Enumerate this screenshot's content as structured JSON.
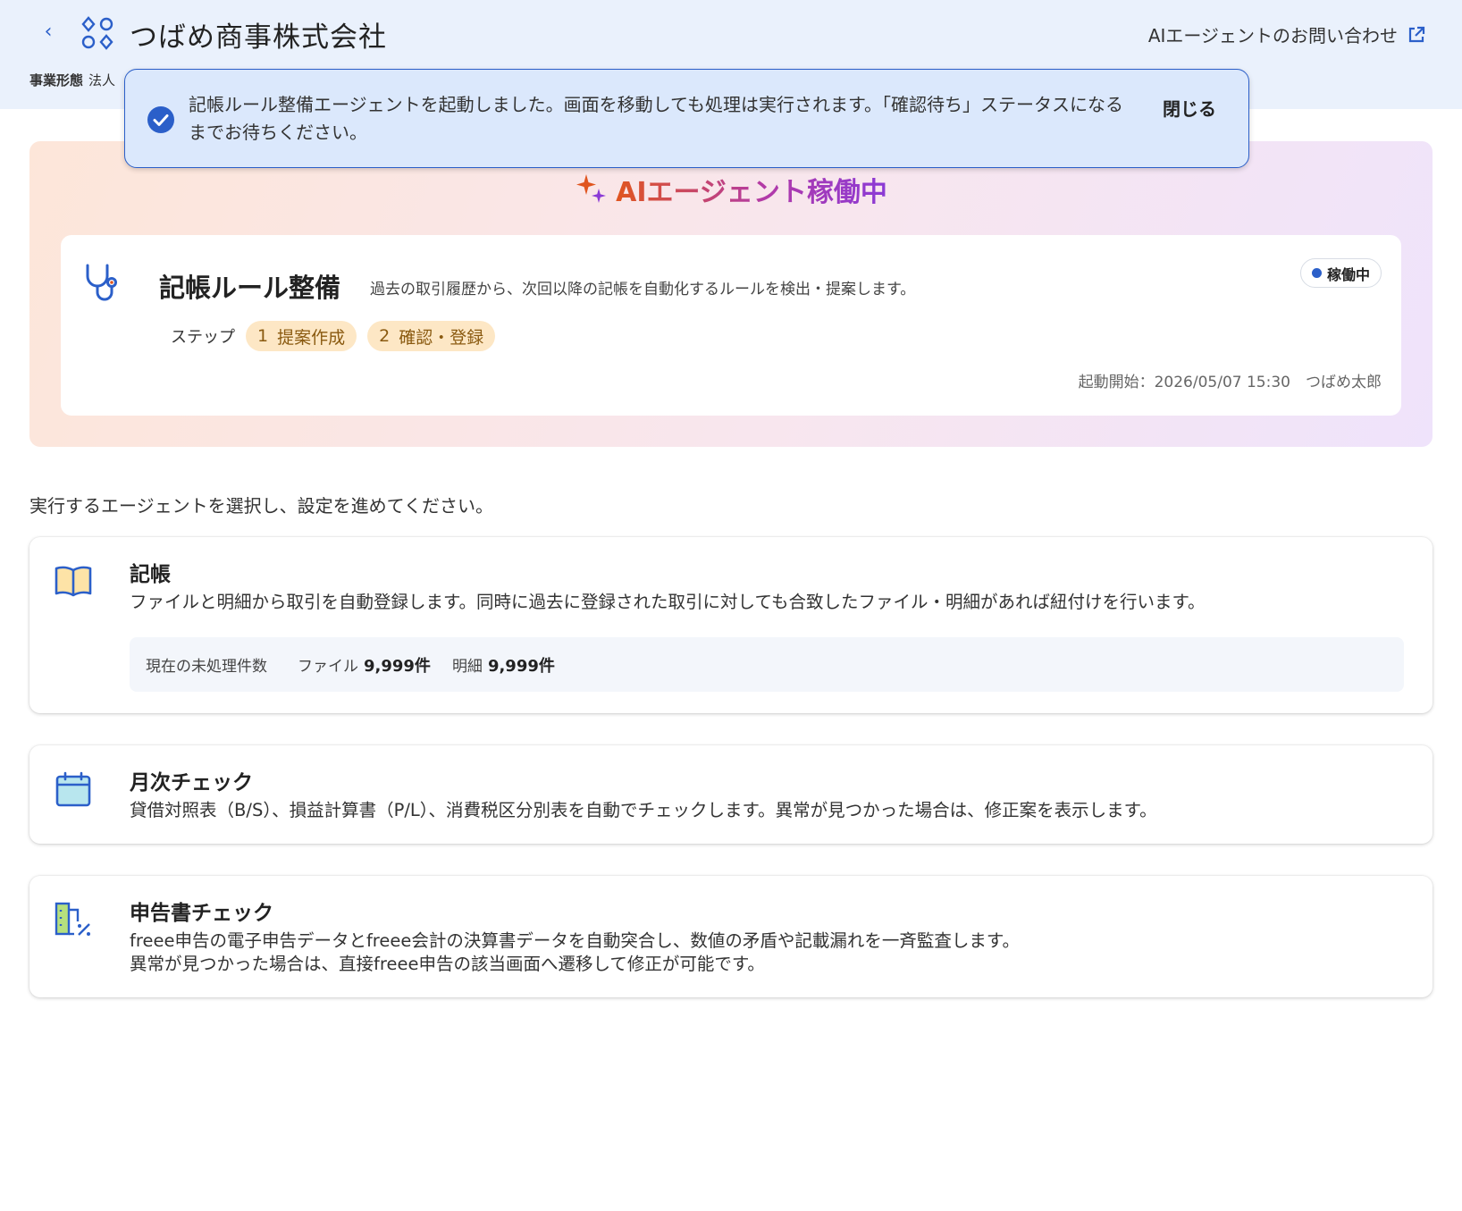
{
  "header": {
    "company_name": "つばめ商事株式会社",
    "contact_link": "AIエージェントのお問い合わせ",
    "business_type_label": "事業形態",
    "business_type_value": "法人"
  },
  "toast": {
    "message": "記帳ルール整備エージェントを起動しました。画面を移動しても処理は実行されます。「確認待ち」ステータスになるまでお待ちください。",
    "close_label": "閉じる"
  },
  "active_panel": {
    "title": "AIエージェント稼働中",
    "agent": {
      "name": "記帳ルール整備",
      "description": "過去の取引履歴から、次回以降の記帳を自動化するルールを検出・提案します。",
      "status": "稼働中",
      "steps_label": "ステップ",
      "steps": [
        {
          "num": "1",
          "label": "提案作成"
        },
        {
          "num": "2",
          "label": "確認・登録"
        }
      ],
      "started_at": "起動開始：2026/05/07 15:30　つばめ太郎"
    }
  },
  "instruction": "実行するエージェントを選択し、設定を進めてください。",
  "agents": [
    {
      "title": "記帳",
      "description": "ファイルと明細から取引を自動登録します。同時に過去に登録された取引に対しても合致したファイル・明細があれば紐付けを行います。",
      "pending": {
        "label": "現在の未処理件数",
        "file_label": "ファイル",
        "file_count": "9,999件",
        "statement_label": "明細",
        "statement_count": "9,999件"
      }
    },
    {
      "title": "月次チェック",
      "description": "貸借対照表（B/S）、損益計算書（P/L）、消費税区分別表を自動でチェックします。異常が見つかった場合は、修正案を表示します。"
    },
    {
      "title": "申告書チェック",
      "description_line1": "freee申告の電子申告データとfreee会計の決算書データを自動突合し、数値の矛盾や記載漏れを一斉監査します。",
      "description_line2": "異常が見つかった場合は、直接freee申告の該当画面へ遷移して修正が可能です。"
    }
  ],
  "colors": {
    "accent_blue": "#2b5fc9",
    "header_bg": "#eaf1fc",
    "toast_bg": "#dbe8fc",
    "step_pill_bg": "#fde7c5"
  },
  "icons": {
    "back": "chevron-left-icon",
    "logo": "app-grid-icon",
    "external": "external-link-icon",
    "toast": "check-circle-icon",
    "sparkle": "sparkle-icon",
    "agent": "stethoscope-icon",
    "bookkeeping": "book-icon",
    "monthly": "calendar-icon",
    "tax": "tax-document-icon"
  }
}
